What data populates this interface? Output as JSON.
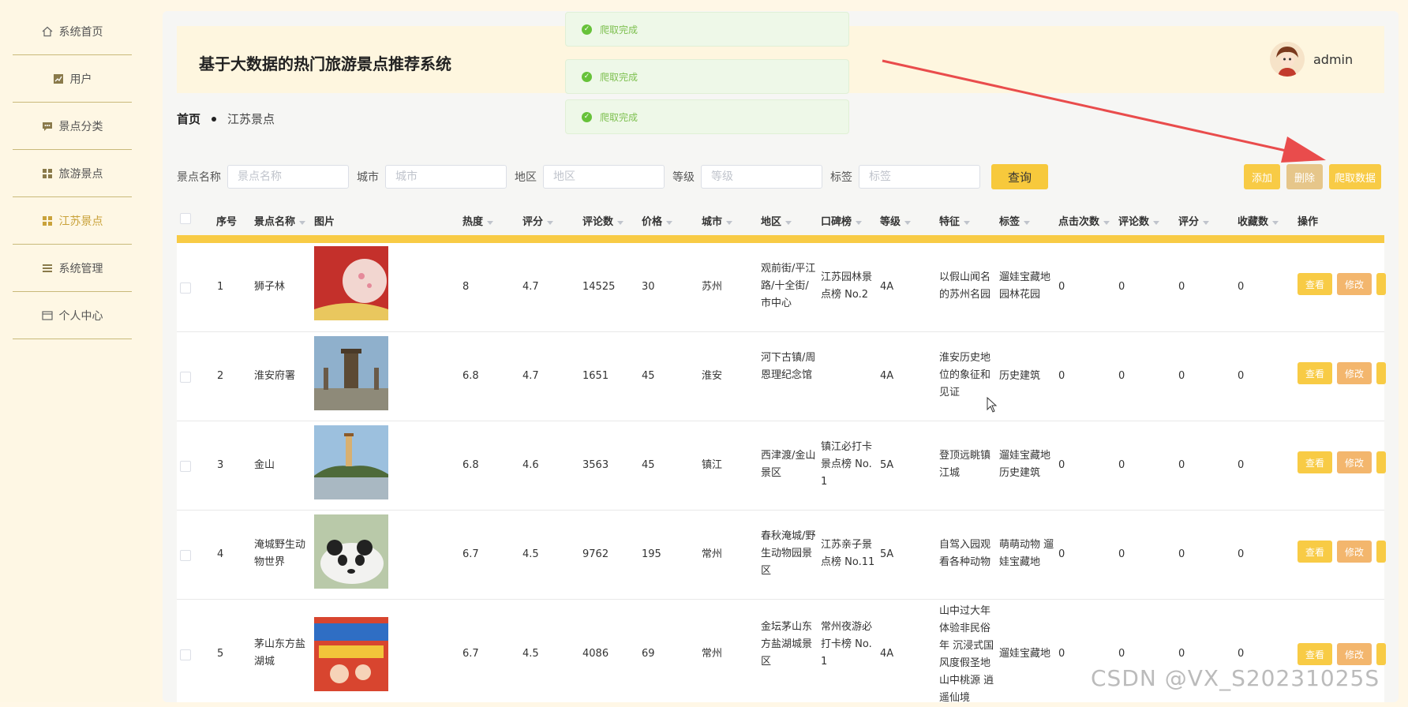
{
  "sidebar": {
    "items": [
      {
        "label": "系统首页",
        "icon": "home-icon"
      },
      {
        "label": "用户",
        "icon": "chart-icon"
      },
      {
        "label": "景点分类",
        "icon": "chat-icon"
      },
      {
        "label": "旅游景点",
        "icon": "grid-icon"
      },
      {
        "label": "江苏景点",
        "icon": "grid-icon",
        "active": true
      },
      {
        "label": "系统管理",
        "icon": "list-icon"
      },
      {
        "label": "个人中心",
        "icon": "card-icon"
      }
    ]
  },
  "header": {
    "title": "基于大数据的热门旅游景点推荐系统",
    "user": "admin"
  },
  "toasts": [
    "爬取完成",
    "爬取完成",
    "爬取完成"
  ],
  "breadcrumb": {
    "home": "首页",
    "current": "江苏景点"
  },
  "search": {
    "fields": [
      {
        "label": "景点名称",
        "placeholder": "景点名称"
      },
      {
        "label": "城市",
        "placeholder": "城市"
      },
      {
        "label": "地区",
        "placeholder": "地区"
      },
      {
        "label": "等级",
        "placeholder": "等级"
      },
      {
        "label": "标签",
        "placeholder": "标签"
      }
    ],
    "query_label": "查询"
  },
  "actions": {
    "add": "添加",
    "delete": "删除",
    "crawl": "爬取数据"
  },
  "table": {
    "headers": [
      "序号",
      "景点名称",
      "图片",
      "热度",
      "评分",
      "评论数",
      "价格",
      "城市",
      "地区",
      "口碑榜",
      "等级",
      "特征",
      "标签",
      "点击次数",
      "评论数",
      "评分",
      "收藏数",
      "操作"
    ],
    "ops": {
      "view": "查看",
      "edit": "修改"
    },
    "rows": [
      {
        "no": "1",
        "name": "狮子林",
        "heat": "8",
        "score": "4.7",
        "comments": "14525",
        "price": "30",
        "city": "苏州",
        "area": "观前街/平江路/十全街/市中心",
        "rank": "江苏园林景点榜 No.2",
        "level": "4A",
        "feature": "以假山闻名的苏州名园",
        "tags": "遛娃宝藏地 园林花园",
        "clicks": "0",
        "cmt2": "0",
        "score2": "0",
        "fav": "0",
        "thumb": "#c4302b"
      },
      {
        "no": "2",
        "name": "淮安府署",
        "heat": "6.8",
        "score": "4.7",
        "comments": "1651",
        "price": "45",
        "city": "淮安",
        "area": "河下古镇/周恩理纪念馆",
        "rank": "",
        "level": "4A",
        "feature": "淮安历史地位的象征和见证",
        "tags": "历史建筑",
        "clicks": "0",
        "cmt2": "0",
        "score2": "0",
        "fav": "0",
        "thumb": "#6f8fa8"
      },
      {
        "no": "3",
        "name": "金山",
        "heat": "6.8",
        "score": "4.6",
        "comments": "3563",
        "price": "45",
        "city": "镇江",
        "area": "西津渡/金山景区",
        "rank": "镇江必打卡景点榜 No. 1",
        "level": "5A",
        "feature": "登顶远眺镇江城",
        "tags": "遛娃宝藏地 历史建筑",
        "clicks": "0",
        "cmt2": "0",
        "score2": "0",
        "fav": "0",
        "thumb": "#8fb4d4"
      },
      {
        "no": "4",
        "name": "淹城野生动物世界",
        "heat": "6.7",
        "score": "4.5",
        "comments": "9762",
        "price": "195",
        "city": "常州",
        "area": "春秋淹城/野生动物园景区",
        "rank": "江苏亲子景点榜 No.11",
        "level": "5A",
        "feature": "自驾入园观看各种动物",
        "tags": "萌萌动物 遛娃宝藏地",
        "clicks": "0",
        "cmt2": "0",
        "score2": "0",
        "fav": "0",
        "thumb": "#b9c9a9"
      },
      {
        "no": "5",
        "name": "茅山东方盐湖城",
        "heat": "6.7",
        "score": "4.5",
        "comments": "4086",
        "price": "69",
        "city": "常州",
        "area": "金坛茅山东方盐湖城景区",
        "rank": "常州夜游必打卡榜 No. 1",
        "level": "4A",
        "feature": "山中过大年 体验非民俗年 沉浸式国风度假圣地 山中桃源 逍遥仙境",
        "tags": "遛娃宝藏地",
        "clicks": "0",
        "cmt2": "0",
        "score2": "0",
        "fav": "0",
        "thumb": "#d8452f"
      }
    ]
  },
  "watermark": "CSDN @VX_S20231025S",
  "colors": {
    "accent": "#f8cb45",
    "toast_bg": "#eef8e8",
    "success": "#67c23a",
    "edit": "#f3b66d"
  }
}
